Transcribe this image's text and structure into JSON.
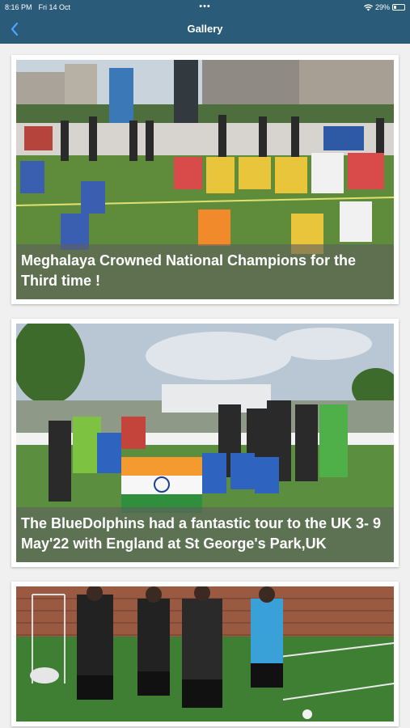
{
  "status": {
    "time": "8:16 PM",
    "date": "Fri 14 Oct",
    "center_dots": "•••",
    "battery": "29%",
    "battery_level": 0.29
  },
  "nav": {
    "title": "Gallery",
    "back_icon": "chevron-left-icon"
  },
  "gallery": {
    "items": [
      {
        "caption": "Meghalaya Crowned National Champions for the Third time !"
      },
      {
        "caption": "The BlueDolphins had a fantastic tour to the UK 3- 9 May'22 with England at St George's Park,UK"
      },
      {
        "caption": ""
      }
    ]
  },
  "colors": {
    "header": "#2a5b78",
    "background": "#f0f0f0",
    "caption_overlay": "rgba(95,95,95,0.62)"
  }
}
